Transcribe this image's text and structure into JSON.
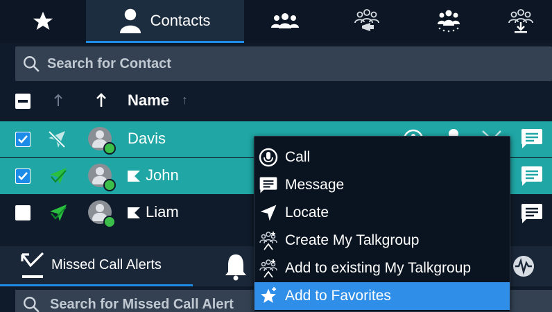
{
  "tabs": {
    "favorites": "favorites-star",
    "contacts_label": "Contacts",
    "groups": "groups",
    "broadcast": "broadcast-talkgroup",
    "scanned": "scanned-groups",
    "download": "download-groups"
  },
  "search": {
    "placeholder": "Search for Contact"
  },
  "header": {
    "name_label": "Name"
  },
  "rows": [
    {
      "name": "Davis",
      "checked": true,
      "selected": true
    },
    {
      "name": "John",
      "checked": true,
      "selected": true
    },
    {
      "name": "Liam",
      "checked": false,
      "selected": false
    }
  ],
  "bottom": {
    "missed_label": "Missed Call Alerts",
    "search_placeholder": "Search for Missed Call Alert"
  },
  "context_menu": {
    "items": [
      {
        "label": "Call",
        "icon": "call-icon"
      },
      {
        "label": "Message",
        "icon": "message-icon"
      },
      {
        "label": "Locate",
        "icon": "locate-icon"
      },
      {
        "label": "Create My Talkgroup",
        "icon": "talkgroup-icon"
      },
      {
        "label": "Add to existing My Talkgroup",
        "icon": "talkgroup-icon"
      },
      {
        "label": "Add to Favorites",
        "icon": "star-icon",
        "highlighted": true
      }
    ]
  },
  "colors": {
    "accent": "#1d8be8",
    "selected_row": "#1fa6a5",
    "menu_highlight": "#2f8fe8",
    "background": "#0f1b2a"
  }
}
